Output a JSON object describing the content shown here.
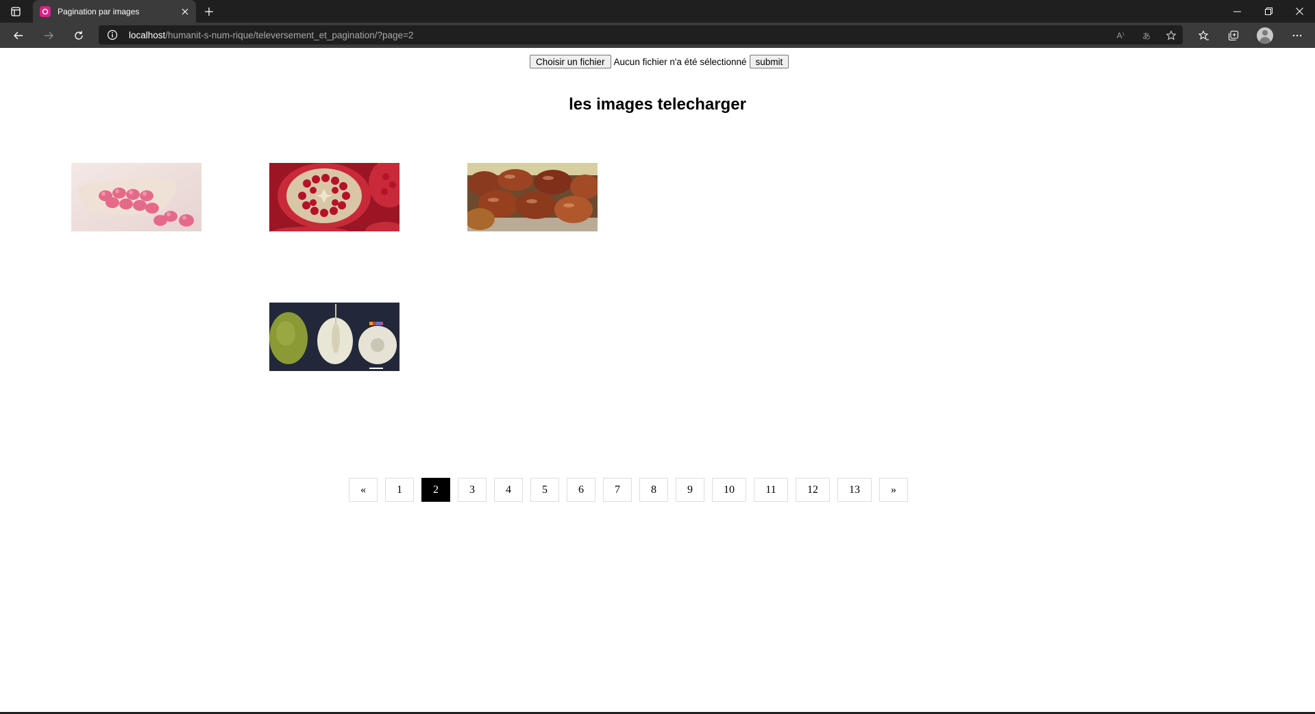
{
  "browser": {
    "tab_title": "Pagination par images",
    "url_host": "localhost",
    "url_path": "/humanit-s-num-rique/televersement_et_pagination/?page=2",
    "read_aloud_label": "A⁾",
    "translate_label": "あ"
  },
  "upload": {
    "choose_label": "Choisir un fichier",
    "status": "Aucun fichier n'a été sélectionné",
    "submit_label": "submit"
  },
  "page": {
    "heading": "les images telecharger"
  },
  "gallery": {
    "images": [
      {
        "name": "pink-berries-bowl"
      },
      {
        "name": "pomegranate-halves"
      },
      {
        "name": "red-jujube-fruits"
      },
      {
        "name": "breadfruit-cross-section"
      }
    ]
  },
  "pagination": {
    "prev": "«",
    "next": "»",
    "pages": [
      "1",
      "2",
      "3",
      "4",
      "5",
      "6",
      "7",
      "8",
      "9",
      "10",
      "11",
      "12",
      "13"
    ],
    "current": "2"
  },
  "colors": {
    "chrome_dark": "#1f1f1f",
    "chrome_mid": "#3b3b3b",
    "tab_icon": "#d6228b",
    "active_page": "#000000"
  }
}
